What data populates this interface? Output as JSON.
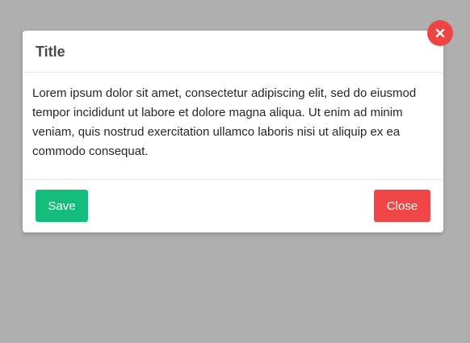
{
  "modal": {
    "title": "Title",
    "body_text": "Lorem ipsum dolor sit amet, consectetur adipiscing elit, sed do eiusmod tempor incididunt ut labore et dolore magna aliqua. Ut enim ad minim veniam, quis nostrud exercitation ullamco laboris nisi ut aliquip ex ea commodo consequat.",
    "save_label": "Save",
    "close_label": "Close",
    "close_icon": "close-icon"
  },
  "colors": {
    "backdrop": "#afafaf",
    "save_button": "#15bd7c",
    "close_button": "#f04646",
    "close_x_badge": "#ef4444"
  }
}
